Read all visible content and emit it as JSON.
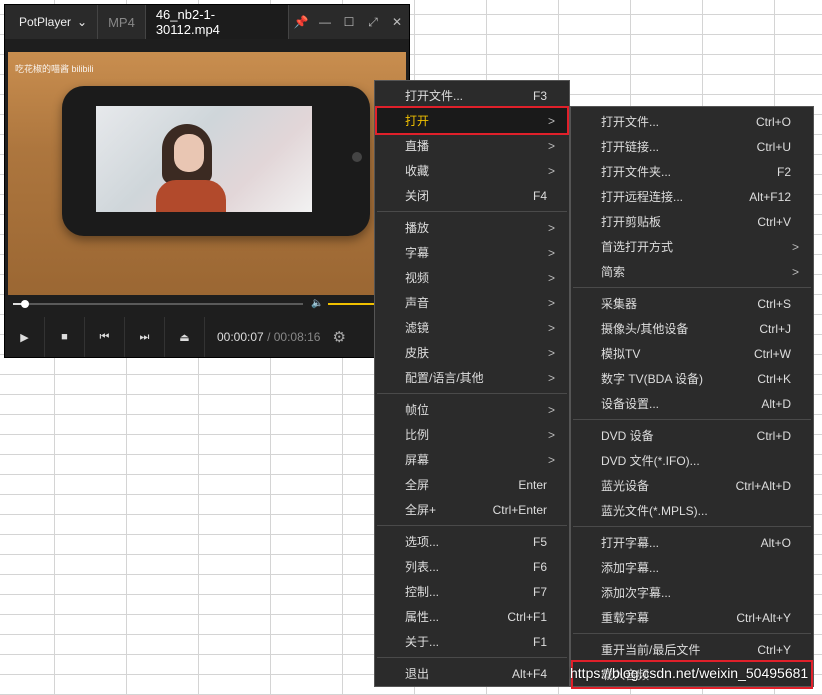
{
  "player": {
    "app_name": "PotPlayer",
    "tab_format": "MP4",
    "tab_file": "46_nb2-1-30112.mp4",
    "watermark": "吃花椒的喵酱 bilibili",
    "time_current": "00:00:07",
    "time_sep": "/",
    "time_total": "00:08:16",
    "progress_fraction": 0.04,
    "volume_fraction": 1.0
  },
  "menu_main": [
    {
      "label": "打开文件...",
      "shortcut": "F3"
    },
    {
      "label": "打开",
      "arrow": ">"
    },
    {
      "label": "直播",
      "arrow": ">"
    },
    {
      "label": "收藏",
      "arrow": ">"
    },
    {
      "label": "关闭",
      "shortcut": "F4"
    },
    {
      "sep": true
    },
    {
      "label": "播放",
      "arrow": ">"
    },
    {
      "label": "字幕",
      "arrow": ">"
    },
    {
      "label": "视频",
      "arrow": ">"
    },
    {
      "label": "声音",
      "arrow": ">"
    },
    {
      "label": "滤镜",
      "arrow": ">"
    },
    {
      "label": "皮肤",
      "arrow": ">"
    },
    {
      "label": "配置/语言/其他",
      "arrow": ">"
    },
    {
      "sep": true
    },
    {
      "label": "帧位",
      "arrow": ">"
    },
    {
      "label": "比例",
      "arrow": ">"
    },
    {
      "label": "屏幕",
      "arrow": ">"
    },
    {
      "label": "全屏",
      "shortcut": "Enter"
    },
    {
      "label": "全屏+",
      "shortcut": "Ctrl+Enter"
    },
    {
      "sep": true
    },
    {
      "label": "选项...",
      "shortcut": "F5"
    },
    {
      "label": "列表...",
      "shortcut": "F6"
    },
    {
      "label": "控制...",
      "shortcut": "F7"
    },
    {
      "label": "属性...",
      "shortcut": "Ctrl+F1"
    },
    {
      "label": "关于...",
      "shortcut": "F1"
    },
    {
      "sep": true
    },
    {
      "label": "退出",
      "shortcut": "Alt+F4"
    }
  ],
  "menu_sub": [
    {
      "label": "打开文件...",
      "shortcut": "Ctrl+O"
    },
    {
      "label": "打开链接...",
      "shortcut": "Ctrl+U"
    },
    {
      "label": "打开文件夹...",
      "shortcut": "F2"
    },
    {
      "label": "打开远程连接...",
      "shortcut": "Alt+F12"
    },
    {
      "label": "打开剪贴板",
      "shortcut": "Ctrl+V"
    },
    {
      "label": "首选打开方式",
      "arrow": ">"
    },
    {
      "label": "简索",
      "arrow": ">"
    },
    {
      "sep": true
    },
    {
      "label": "采集器",
      "shortcut": "Ctrl+S"
    },
    {
      "label": "摄像头/其他设备",
      "shortcut": "Ctrl+J"
    },
    {
      "label": "模拟TV",
      "shortcut": "Ctrl+W"
    },
    {
      "label": "数字 TV(BDA 设备)",
      "shortcut": "Ctrl+K"
    },
    {
      "label": "设备设置...",
      "shortcut": "Alt+D"
    },
    {
      "sep": true
    },
    {
      "label": "DVD 设备",
      "shortcut": "Ctrl+D"
    },
    {
      "label": "DVD 文件(*.IFO)..."
    },
    {
      "label": "蓝光设备",
      "shortcut": "Ctrl+Alt+D"
    },
    {
      "label": "蓝光文件(*.MPLS)..."
    },
    {
      "sep": true
    },
    {
      "label": "打开字幕...",
      "shortcut": "Alt+O"
    },
    {
      "label": "添加字幕..."
    },
    {
      "label": "添加次字幕..."
    },
    {
      "label": "重载字幕",
      "shortcut": "Ctrl+Alt+Y"
    },
    {
      "sep": true
    },
    {
      "label": "重开当前/最后文件",
      "shortcut": "Ctrl+Y"
    },
    {
      "label": "载入音频"
    }
  ],
  "credit": "https://blog.csdn.net/weixin_50495681",
  "colors": {
    "highlight_text": "#f0c000",
    "highlight_border": "#e0202a",
    "menu_bg": "#2b2b2b"
  }
}
